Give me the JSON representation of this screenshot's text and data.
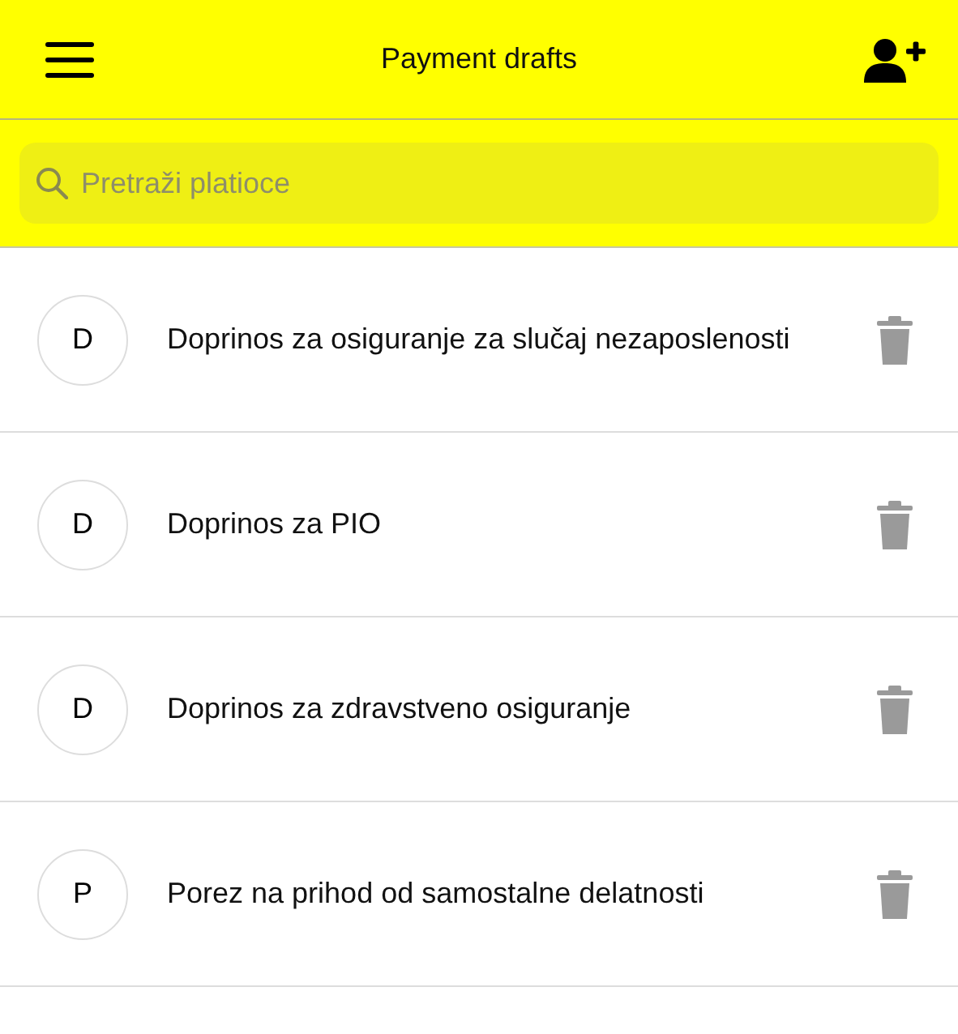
{
  "header": {
    "title": "Payment drafts"
  },
  "search": {
    "placeholder": "Pretraži platioce"
  },
  "drafts": [
    {
      "initial": "D",
      "name": "Doprinos za osiguranje za slučaj nezaposlenosti"
    },
    {
      "initial": "D",
      "name": "Doprinos za PIO"
    },
    {
      "initial": "D",
      "name": "Doprinos za zdravstveno osiguranje"
    },
    {
      "initial": "P",
      "name": "Porez na prihod od samostalne delatnosti"
    }
  ]
}
